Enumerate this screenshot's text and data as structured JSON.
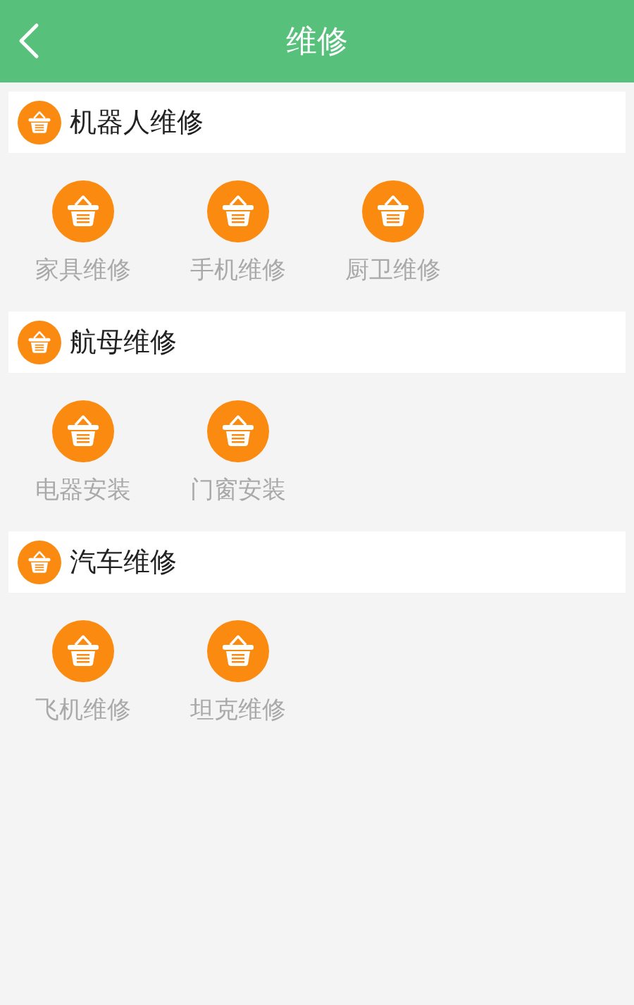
{
  "header": {
    "title": "维修"
  },
  "sections": [
    {
      "title": "机器人维修",
      "items": [
        {
          "label": "家具维修"
        },
        {
          "label": "手机维修"
        },
        {
          "label": "厨卫维修"
        }
      ]
    },
    {
      "title": "航母维修",
      "items": [
        {
          "label": "电器安装"
        },
        {
          "label": "门窗安装"
        }
      ]
    },
    {
      "title": "汽车维修",
      "items": [
        {
          "label": "飞机维修"
        },
        {
          "label": "坦克维修"
        }
      ]
    }
  ]
}
